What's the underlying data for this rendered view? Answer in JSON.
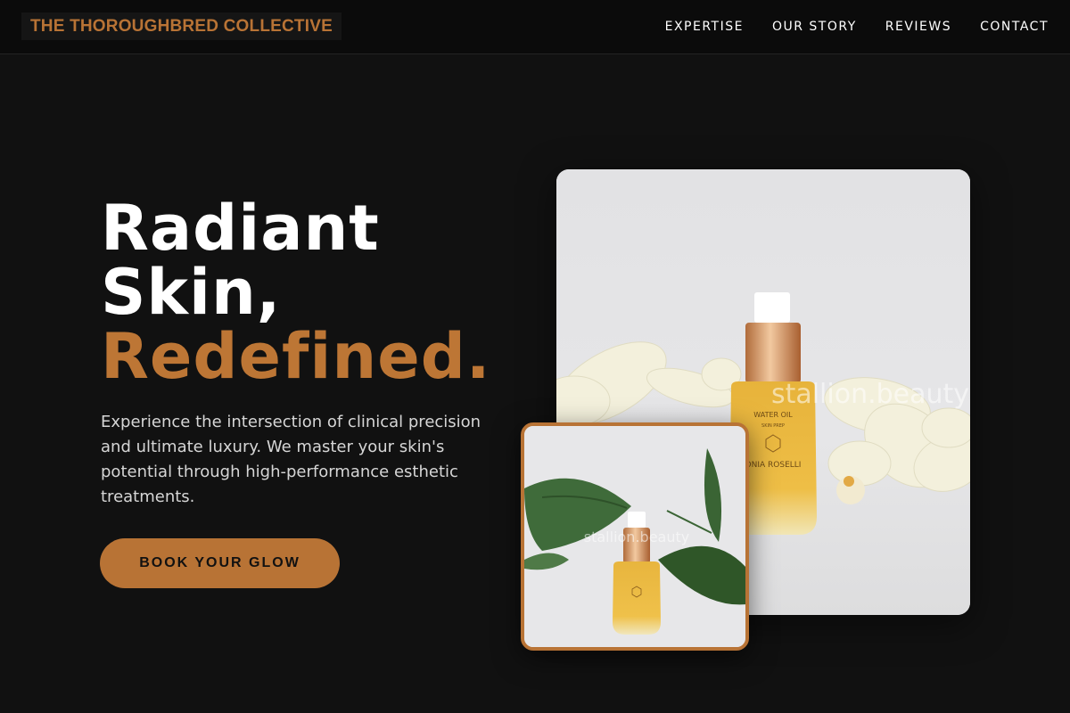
{
  "nav": {
    "brand": "THE THOROUGHBRED COLLECTIVE",
    "links": [
      "EXPERTISE",
      "OUR STORY",
      "REVIEWS",
      "CONTACT"
    ]
  },
  "hero": {
    "title_line1": "Radiant",
    "title_line2": "Skin,",
    "title_accent": "Redefined.",
    "description": "Experience the intersection of clinical precision and ultimate luxury. We master your skin's potential through high-performance esthetic treatments.",
    "cta_label": "BOOK YOUR GLOW"
  },
  "images": {
    "main_watermark": "stallion.beauty",
    "small_watermark": "stallion.beauty",
    "product_label_line1": "WATER OIL",
    "product_label_line2": "SKIN PREP",
    "product_brand": "ONIA ROSELLI"
  },
  "colors": {
    "accent": "#b87335",
    "background": "#111111"
  }
}
